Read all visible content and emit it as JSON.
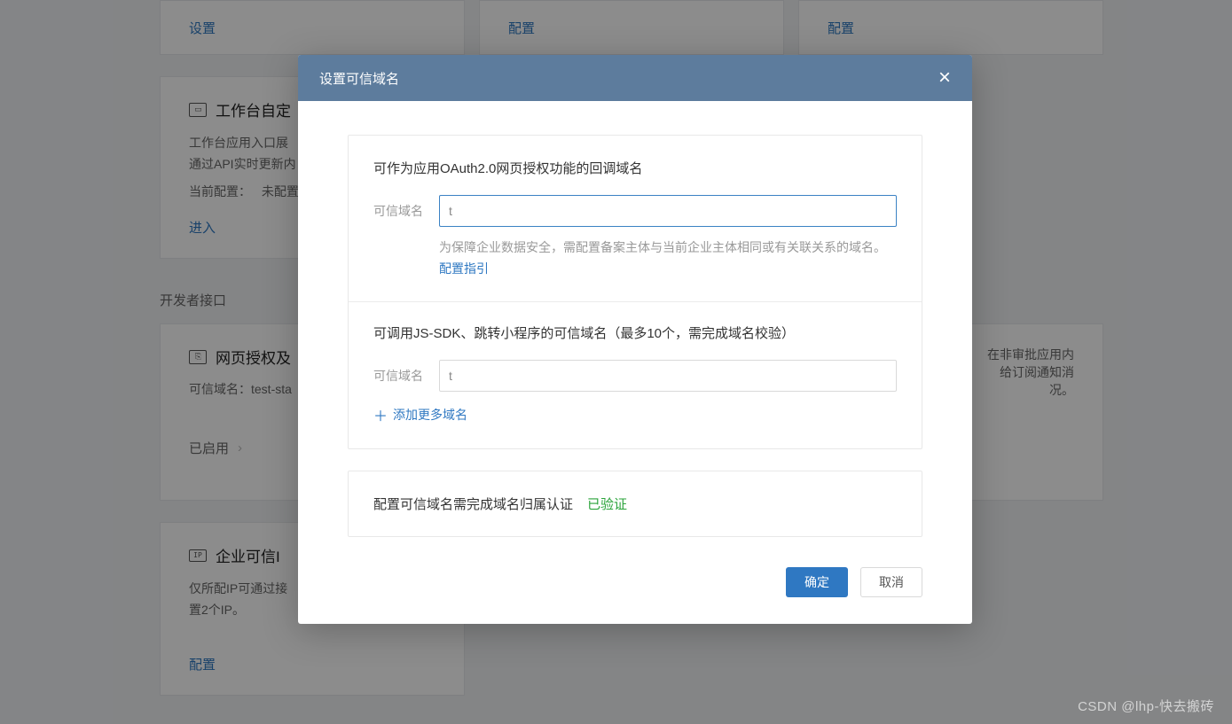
{
  "background": {
    "topRow": {
      "c1": "设置",
      "c2": "配置",
      "c3": "配置"
    },
    "workbench": {
      "title": "工作台自定",
      "desc": "工作台应用入口展\n通过API实时更新内",
      "statusLabel": "当前配置：",
      "statusValue": "未配置",
      "action": "进入"
    },
    "sectionLabel": "开发者接口",
    "auth": {
      "title": "网页授权及",
      "subLabel": "可信域名：",
      "subValue": "test-sta",
      "enabled": "已启用"
    },
    "rightFragment": "在非审批应用内\n给订阅通知消\n况。",
    "ip": {
      "title": "企业可信I",
      "desc": "仅所配IP可通过接\n置2个IP。",
      "action": "配置"
    }
  },
  "modal": {
    "title": "设置可信域名",
    "section1": {
      "title": "可作为应用OAuth2.0网页授权功能的回调域名",
      "label": "可信域名",
      "value": "t",
      "hint": "为保障企业数据安全，需配置备案主体与当前企业主体相同或有关联关系的域名。",
      "hintLink": "配置指引"
    },
    "section2": {
      "title": "可调用JS-SDK、跳转小程序的可信域名（最多10个，需完成域名校验）",
      "label": "可信域名",
      "value": "t",
      "addMore": "添加更多域名"
    },
    "verify": {
      "text": "配置可信域名需完成域名归属认证",
      "status": "已验证"
    },
    "buttons": {
      "ok": "确定",
      "cancel": "取消"
    }
  },
  "watermark": "CSDN @lhp-快去搬砖"
}
